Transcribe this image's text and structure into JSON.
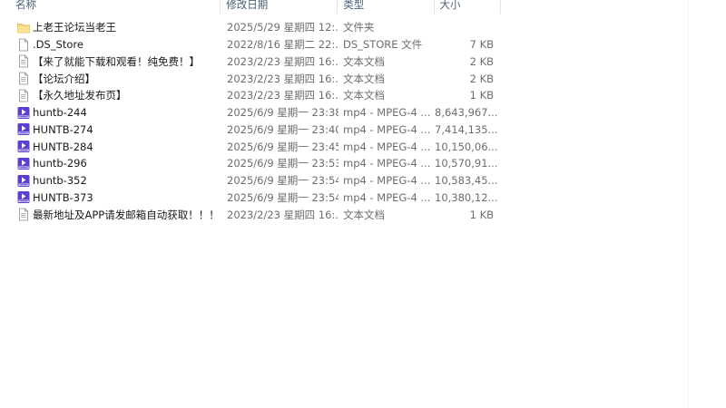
{
  "columns": {
    "name": "名称",
    "date": "修改日期",
    "type": "类型",
    "size": "大小"
  },
  "colors": {
    "header_text": "#4c607a",
    "folder": "#f8d775",
    "video_icon": "#5b3fd1"
  },
  "files": [
    {
      "icon": "folder-icon",
      "name": "上老王论坛当老王",
      "date": "2025/5/29 星期四 12:...",
      "type": "文件夹",
      "size": ""
    },
    {
      "icon": "file-icon",
      "name": ".DS_Store",
      "date": "2022/8/16 星期二 22:...",
      "type": "DS_STORE 文件",
      "size": "7 KB"
    },
    {
      "icon": "text-document-icon",
      "name": "【来了就能下载和观看！纯免费！】",
      "date": "2023/2/23 星期四 16:...",
      "type": "文本文档",
      "size": "2 KB"
    },
    {
      "icon": "text-document-icon",
      "name": "【论坛介绍】",
      "date": "2023/2/23 星期四 16:...",
      "type": "文本文档",
      "size": "2 KB"
    },
    {
      "icon": "text-document-icon",
      "name": "【永久地址发布页】",
      "date": "2023/2/23 星期四 16:...",
      "type": "文本文档",
      "size": "1 KB"
    },
    {
      "icon": "mp4-video-icon",
      "name": "huntb-244",
      "date": "2025/6/9 星期一 23:38",
      "type": "mp4 - MPEG-4 ...",
      "size": "8,643,967..."
    },
    {
      "icon": "mp4-video-icon",
      "name": "HUNTB-274",
      "date": "2025/6/9 星期一 23:40",
      "type": "mp4 - MPEG-4 ...",
      "size": "7,414,135..."
    },
    {
      "icon": "mp4-video-icon",
      "name": "HUNTB-284",
      "date": "2025/6/9 星期一 23:45",
      "type": "mp4 - MPEG-4 ...",
      "size": "10,150,06..."
    },
    {
      "icon": "mp4-video-icon",
      "name": "huntb-296",
      "date": "2025/6/9 星期一 23:53",
      "type": "mp4 - MPEG-4 ...",
      "size": "10,570,91..."
    },
    {
      "icon": "mp4-video-icon",
      "name": "huntb-352",
      "date": "2025/6/9 星期一 23:54",
      "type": "mp4 - MPEG-4 ...",
      "size": "10,583,45..."
    },
    {
      "icon": "mp4-video-icon",
      "name": "HUNTB-373",
      "date": "2025/6/9 星期一 23:54",
      "type": "mp4 - MPEG-4 ...",
      "size": "10,380,12..."
    },
    {
      "icon": "text-document-icon",
      "name": "最新地址及APP请发邮箱自动获取！！！",
      "date": "2023/2/23 星期四 16:...",
      "type": "文本文档",
      "size": "1 KB"
    }
  ]
}
